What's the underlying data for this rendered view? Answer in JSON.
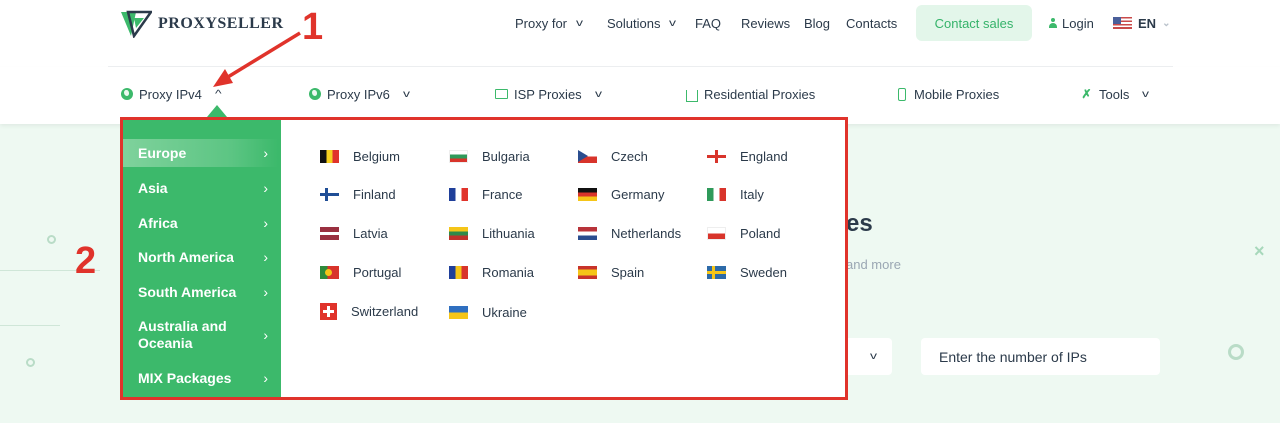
{
  "header": {
    "logo_text": "PROXYSELLER",
    "nav": [
      {
        "label": "Proxy for",
        "has_chevron": true
      },
      {
        "label": "Solutions",
        "has_chevron": true
      },
      {
        "label": "FAQ",
        "has_chevron": false
      },
      {
        "label": "Reviews",
        "has_chevron": false
      },
      {
        "label": "Blog",
        "has_chevron": false
      },
      {
        "label": "Contacts",
        "has_chevron": false
      }
    ],
    "contact_sales": "Contact sales",
    "login": "Login",
    "language": "EN"
  },
  "product_nav": [
    {
      "label": "Proxy IPv4",
      "icon": "globe-icon",
      "chevron": "up"
    },
    {
      "label": "Proxy IPv6",
      "icon": "globe-icon",
      "chevron": "down"
    },
    {
      "label": "ISP Proxies",
      "icon": "monitor-icon",
      "chevron": "down"
    },
    {
      "label": "Residential Proxies",
      "icon": "house-icon",
      "chevron": ""
    },
    {
      "label": "Mobile Proxies",
      "icon": "phone-icon",
      "chevron": ""
    },
    {
      "label": "Tools",
      "icon": "tools-icon",
      "chevron": "down"
    }
  ],
  "dropdown": {
    "regions": [
      {
        "label": "Europe",
        "active": true
      },
      {
        "label": "Asia",
        "active": false
      },
      {
        "label": "Africa",
        "active": false
      },
      {
        "label": "North America",
        "active": false
      },
      {
        "label": "South America",
        "active": false
      },
      {
        "label": "Australia and Oceania",
        "active": false
      },
      {
        "label": "MIX Packages",
        "active": false
      }
    ],
    "countries": [
      {
        "label": "Belgium",
        "flag": "belgium-flag-icon"
      },
      {
        "label": "Bulgaria",
        "flag": "bulgaria-flag-icon"
      },
      {
        "label": "Czech",
        "flag": "czech-flag-icon"
      },
      {
        "label": "England",
        "flag": "england-flag-icon"
      },
      {
        "label": "Finland",
        "flag": "finland-flag-icon"
      },
      {
        "label": "France",
        "flag": "france-flag-icon"
      },
      {
        "label": "Germany",
        "flag": "germany-flag-icon"
      },
      {
        "label": "Italy",
        "flag": "italy-flag-icon"
      },
      {
        "label": "Latvia",
        "flag": "latvia-flag-icon"
      },
      {
        "label": "Lithuania",
        "flag": "lithuania-flag-icon"
      },
      {
        "label": "Netherlands",
        "flag": "netherlands-flag-icon"
      },
      {
        "label": "Poland",
        "flag": "poland-flag-icon"
      },
      {
        "label": "Portugal",
        "flag": "portugal-flag-icon"
      },
      {
        "label": "Romania",
        "flag": "romania-flag-icon"
      },
      {
        "label": "Spain",
        "flag": "spain-flag-icon"
      },
      {
        "label": "Sweden",
        "flag": "sweden-flag-icon"
      },
      {
        "label": "Switzerland",
        "flag": "switzerland-flag-icon"
      },
      {
        "label": "Ukraine",
        "flag": "ukraine-flag-icon"
      }
    ]
  },
  "hero": {
    "heading_fragment": "es",
    "subtitle_fragment": "and more",
    "ip_placeholder": "Enter the number of IPs"
  },
  "annotations": {
    "marker_1": "1",
    "marker_2": "2"
  },
  "colors": {
    "brand_green": "#3cb96b",
    "annotation_red": "#e0332b",
    "hero_bg": "#eef9f2",
    "text_dark": "#2b3a4a"
  }
}
